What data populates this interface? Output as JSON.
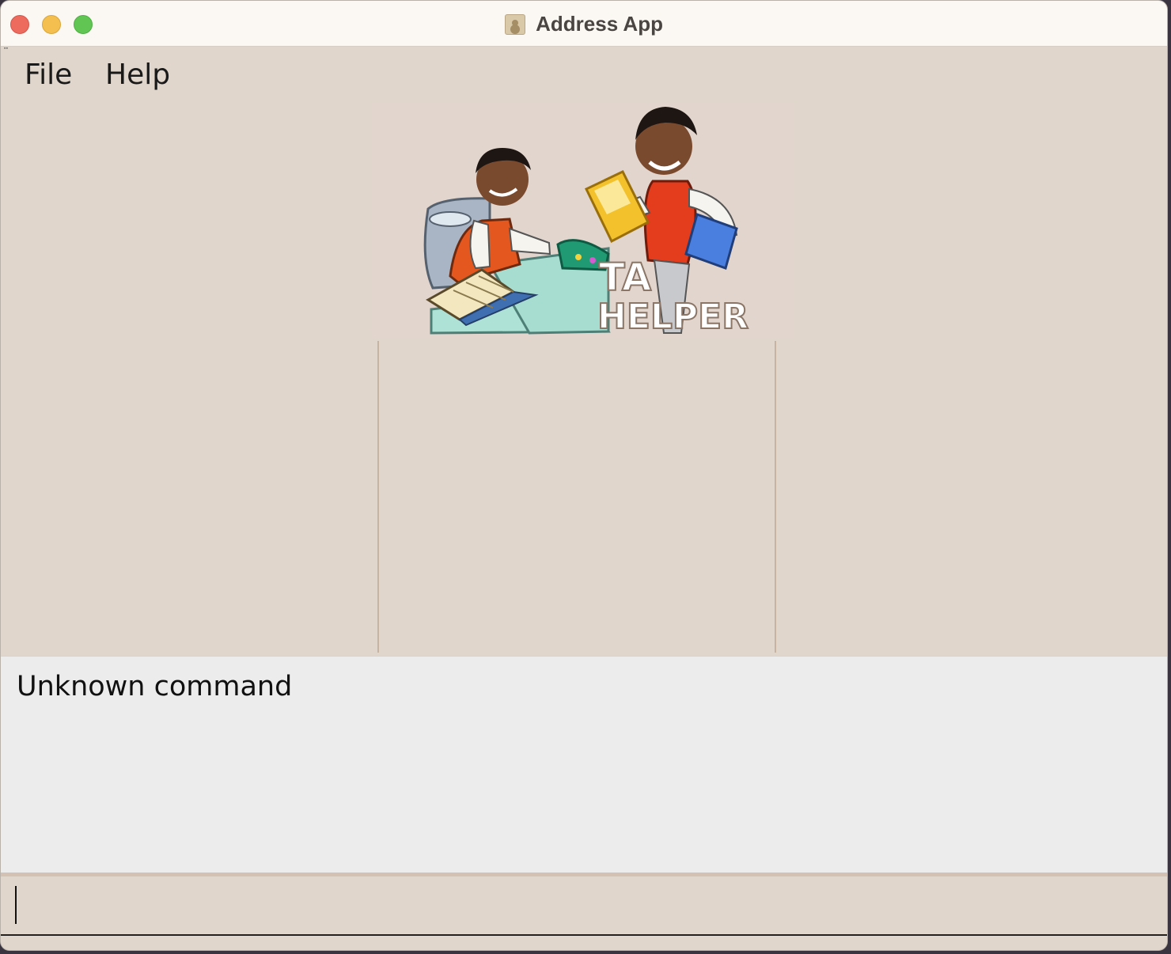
{
  "window": {
    "title": "Address App"
  },
  "menu": {
    "file_label": "File",
    "help_label": "Help"
  },
  "logo": {
    "line1": "TA",
    "line2": "HELPER"
  },
  "result": {
    "message": "Unknown command"
  },
  "command": {
    "value": "",
    "placeholder": ""
  },
  "colors": {
    "background": "#e0d6cc",
    "result_background": "#ececec",
    "titlebar": "#fbf8f3",
    "close": "#ec6a5e",
    "minimize": "#f4bf4f",
    "maximize": "#61c554"
  },
  "icons": [
    "close-icon",
    "minimize-icon",
    "maximize-icon",
    "address-book-icon"
  ]
}
